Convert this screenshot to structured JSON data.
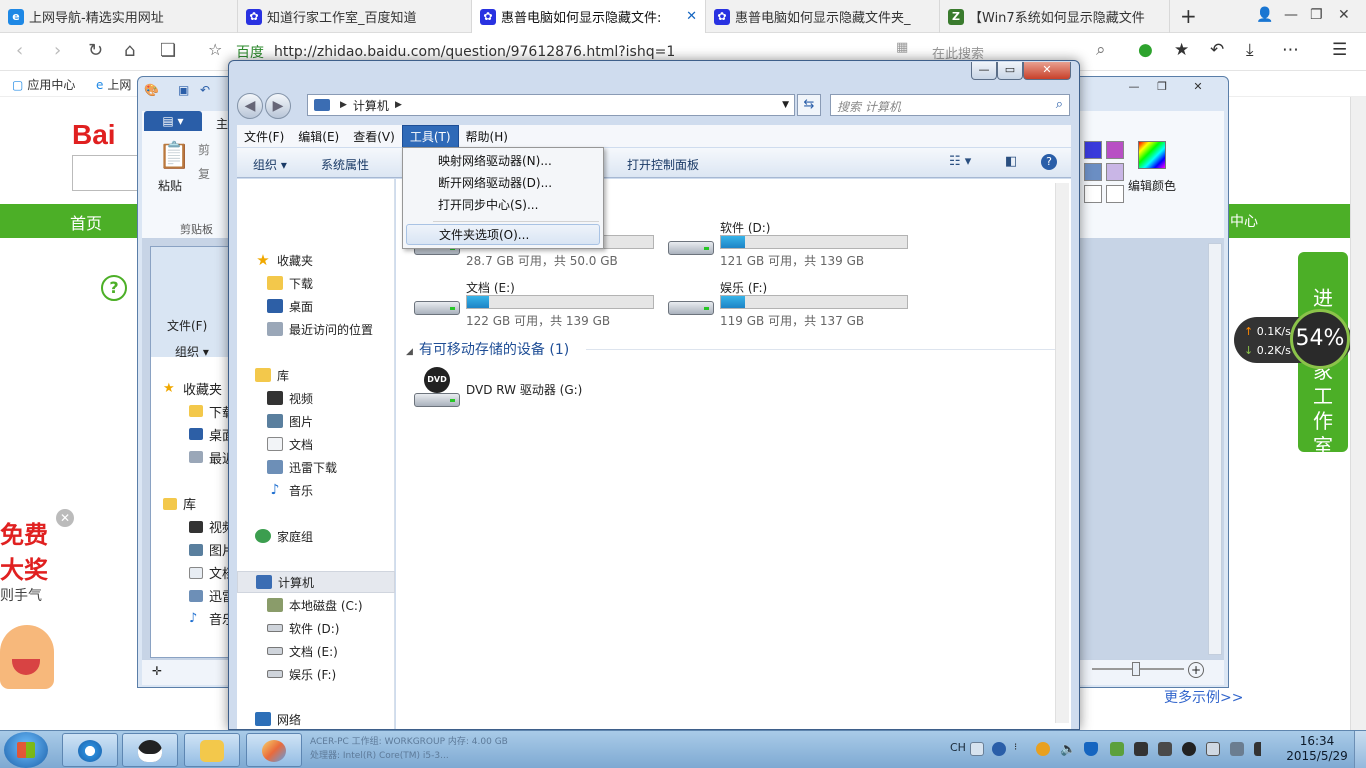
{
  "browser": {
    "tabs": [
      {
        "title": "上网导航-精选实用网址",
        "icon": "ie-icon",
        "color": "#1e88e5"
      },
      {
        "title": "知道行家工作室_百度知道",
        "icon": "baidu-paw-icon",
        "color": "#2932e1"
      },
      {
        "title": "惠普电脑如何显示隐藏文件:",
        "icon": "baidu-paw-icon",
        "color": "#2932e1",
        "active": true
      },
      {
        "title": "惠普电脑如何显示隐藏文件夹_",
        "icon": "baidu-paw-icon",
        "color": "#2932e1"
      },
      {
        "title": "【Win7系统如何显示隐藏文件",
        "icon": "z-icon",
        "color": "#3a7b2e"
      }
    ],
    "new_tab": "+",
    "close_tab": "✕",
    "address": {
      "host_label": "百度",
      "url": "http://zhidao.baidu.com/question/97612876.html?ishq=1"
    },
    "search_placeholder": "在此搜索",
    "bookmarks": [
      {
        "label": "应用中心"
      },
      {
        "label": "上网"
      }
    ]
  },
  "webpage": {
    "logo": "Bai",
    "nav_home": "首页",
    "nav_center": "中心",
    "help_mark": "?",
    "promo": {
      "line1": "免费",
      "line2": "大奖",
      "line3": "则手气"
    },
    "promo_close": "✕",
    "side_banner": "进\n家\n工\n作\n室",
    "side_banner_lines": [
      "进",
      "家",
      "工",
      "作",
      "室"
    ],
    "net": {
      "up": "0.1K/s",
      "down": "0.2K/s",
      "percent": "54%"
    },
    "more_examples": "更多示例>>"
  },
  "paint": {
    "file_tab": "▤ ▾",
    "home_tab": "主",
    "paste": "粘贴",
    "clipboard": "剪贴板",
    "cut": "剪",
    "copy": "复",
    "edit_colors": "编辑颜色",
    "swatches": [
      "#3a3adb",
      "#b84fc4",
      "#6b8ec3",
      "#c9b6e6",
      "#ffffff",
      "#ffffff"
    ],
    "zoom_plus": "+"
  },
  "back_explorer": {
    "menu": "文件(F)",
    "organize": "组织 ▾",
    "items": [
      "收藏夹",
      "下载",
      "桌面",
      "最近",
      "库",
      "视频",
      "图片",
      "文档",
      "迅雷",
      "音乐"
    ]
  },
  "explorer": {
    "address_path": "计算机",
    "search_placeholder": "搜索 计算机",
    "menu": [
      "文件(F)",
      "编辑(E)",
      "查看(V)",
      "工具(T)",
      "帮助(H)"
    ],
    "open_menu_index": 3,
    "commands": [
      "组织 ▾",
      "系统属性",
      "打开控制面板"
    ],
    "nav": {
      "favorites": "收藏夹",
      "downloads": "下载",
      "desktop": "桌面",
      "recent": "最近访问的位置",
      "libraries": "库",
      "videos": "视频",
      "pictures": "图片",
      "documents": "文档",
      "thunder": "迅雷下载",
      "music": "音乐",
      "homegroup": "家庭组",
      "computer": "计算机",
      "drive_c": "本地磁盘 (C:)",
      "drive_d": "软件 (D:)",
      "drive_e": "文档 (E:)",
      "drive_f": "娱乐 (F:)",
      "network": "网络"
    },
    "drives": [
      {
        "name": "",
        "free": "28.7 GB 可用，共 50.0 GB",
        "used_fraction": 0.43
      },
      {
        "name": "软件 (D:)",
        "free": "121 GB 可用，共 139 GB",
        "used_fraction": 0.13
      },
      {
        "name": "文档 (E:)",
        "free": "122 GB 可用，共 139 GB",
        "used_fraction": 0.12
      },
      {
        "name": "娱乐 (F:)",
        "free": "119 GB 可用，共 137 GB",
        "used_fraction": 0.13
      }
    ],
    "removable_header": "有可移动存储的设备 (1)",
    "dvd_label": "DVD",
    "dvd_name": "DVD RW 驱动器 (G:)",
    "tools_menu": [
      {
        "label": "映射网络驱动器(N)..."
      },
      {
        "label": "断开网络驱动器(D)..."
      },
      {
        "label": "打开同步中心(S)..."
      },
      {
        "label": "文件夹选项(O)...",
        "highlighted": true
      }
    ]
  },
  "taskbar": {
    "info_line1": "ACER-PC   工作组: WORKGROUP        内存: 4.00 GB",
    "info_line2": "           处理器: Intel(R) Core(TM) i5-3...",
    "lang": "CH",
    "time": "16:34",
    "date": "2015/5/29"
  }
}
